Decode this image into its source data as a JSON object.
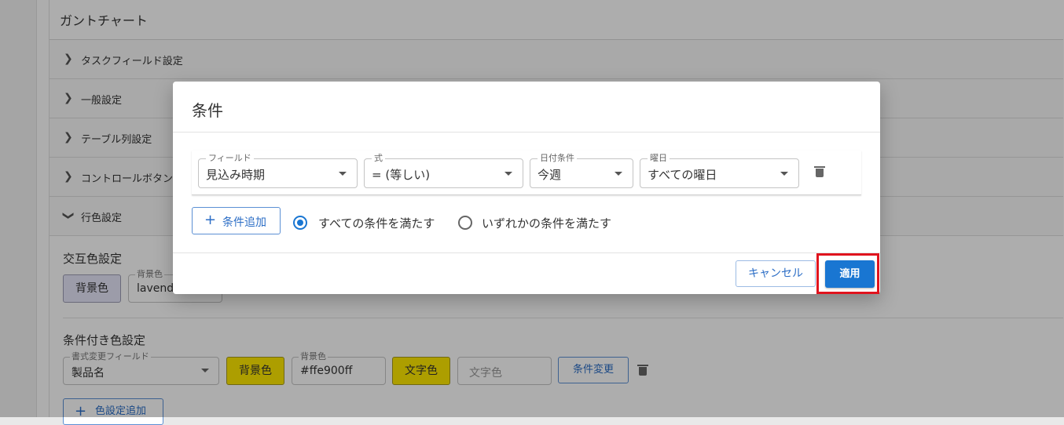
{
  "background": {
    "view_name_value": "ガントチャート",
    "sections": [
      {
        "label": "タスクフィールド設定"
      },
      {
        "label": "一般設定"
      },
      {
        "label": "テーブル列設定"
      },
      {
        "label": "コントロールボタン"
      },
      {
        "label": "行色設定"
      }
    ],
    "alternate_color": {
      "title": "交互色設定",
      "bg_button": "背景色",
      "bg_field_label": "背景色",
      "bg_field_value": "lavend"
    },
    "conditional_color": {
      "title": "条件付き色設定",
      "format_field_label": "書式変更フィールド",
      "format_field_value": "製品名",
      "bg_button": "背景色",
      "bg_field_label": "背景色",
      "bg_field_value": "#ffe900ff",
      "text_button": "文字色",
      "text_field_placeholder": "文字色",
      "change_condition_button": "条件変更",
      "add_button": "色設定追加"
    }
  },
  "dialog": {
    "title": "条件",
    "condition": {
      "field": {
        "label": "フィールド",
        "value": "見込み時期"
      },
      "operator": {
        "label": "式",
        "value": "= (等しい)"
      },
      "date_condition": {
        "label": "日付条件",
        "value": "今週"
      },
      "weekday": {
        "label": "曜日",
        "value": "すべての曜日"
      }
    },
    "add_condition_label": "条件追加",
    "match_all_label": "すべての条件を満たす",
    "match_any_label": "いずれかの条件を満たす",
    "cancel_label": "キャンセル",
    "apply_label": "適用"
  },
  "colors": {
    "accent": "#1976d2",
    "highlight": "#e0141e",
    "lavender": "#e6e6fa",
    "yellow": "#ffe900"
  }
}
